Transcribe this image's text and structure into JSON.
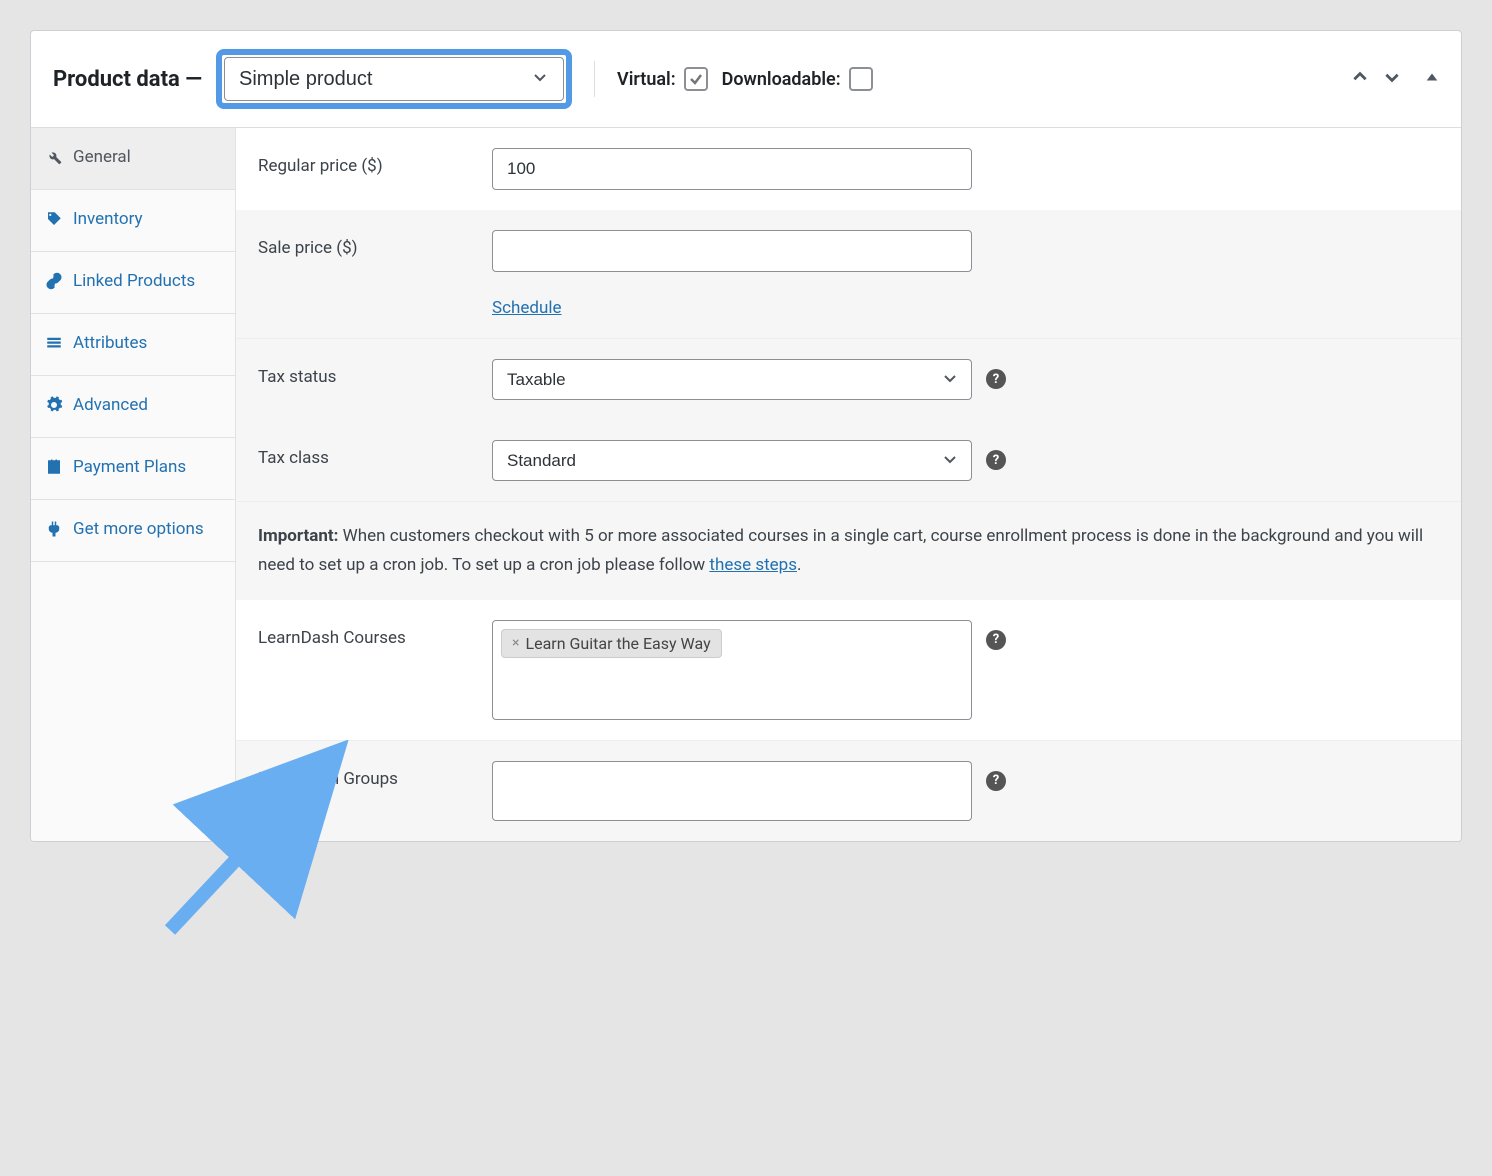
{
  "header": {
    "title": "Product data —",
    "product_type": "Simple product",
    "virtual_label": "Virtual:",
    "virtual_checked": true,
    "downloadable_label": "Downloadable:",
    "downloadable_checked": false
  },
  "tabs": [
    {
      "id": "general",
      "label": "General",
      "icon": "wrench",
      "active": true
    },
    {
      "id": "inventory",
      "label": "Inventory",
      "icon": "tag",
      "active": false
    },
    {
      "id": "linked",
      "label": "Linked Products",
      "icon": "link",
      "active": false
    },
    {
      "id": "attributes",
      "label": "Attributes",
      "icon": "list",
      "active": false
    },
    {
      "id": "advanced",
      "label": "Advanced",
      "icon": "gear",
      "active": false
    },
    {
      "id": "payment",
      "label": "Payment Plans",
      "icon": "calendar",
      "active": false
    },
    {
      "id": "more",
      "label": "Get more options",
      "icon": "plug",
      "active": false
    }
  ],
  "fields": {
    "regular_price_label": "Regular price ($)",
    "regular_price_value": "100",
    "sale_price_label": "Sale price ($)",
    "sale_price_value": "",
    "schedule_link": "Schedule",
    "tax_status_label": "Tax status",
    "tax_status_value": "Taxable",
    "tax_class_label": "Tax class",
    "tax_class_value": "Standard",
    "learndash_courses_label": "LearnDash Courses",
    "learndash_groups_label": "LearnDash Groups",
    "course_tag": "Learn Guitar the Easy Way"
  },
  "notice": {
    "bold": "Important:",
    "text1": " When customers checkout with 5 or more associated courses in a single cart, course enrollment process is done in the background and you will need to set up a cron job. To set up a cron job please follow ",
    "link": "these steps",
    "text2": "."
  },
  "icons": {
    "help": "?",
    "tag_remove": "×"
  }
}
